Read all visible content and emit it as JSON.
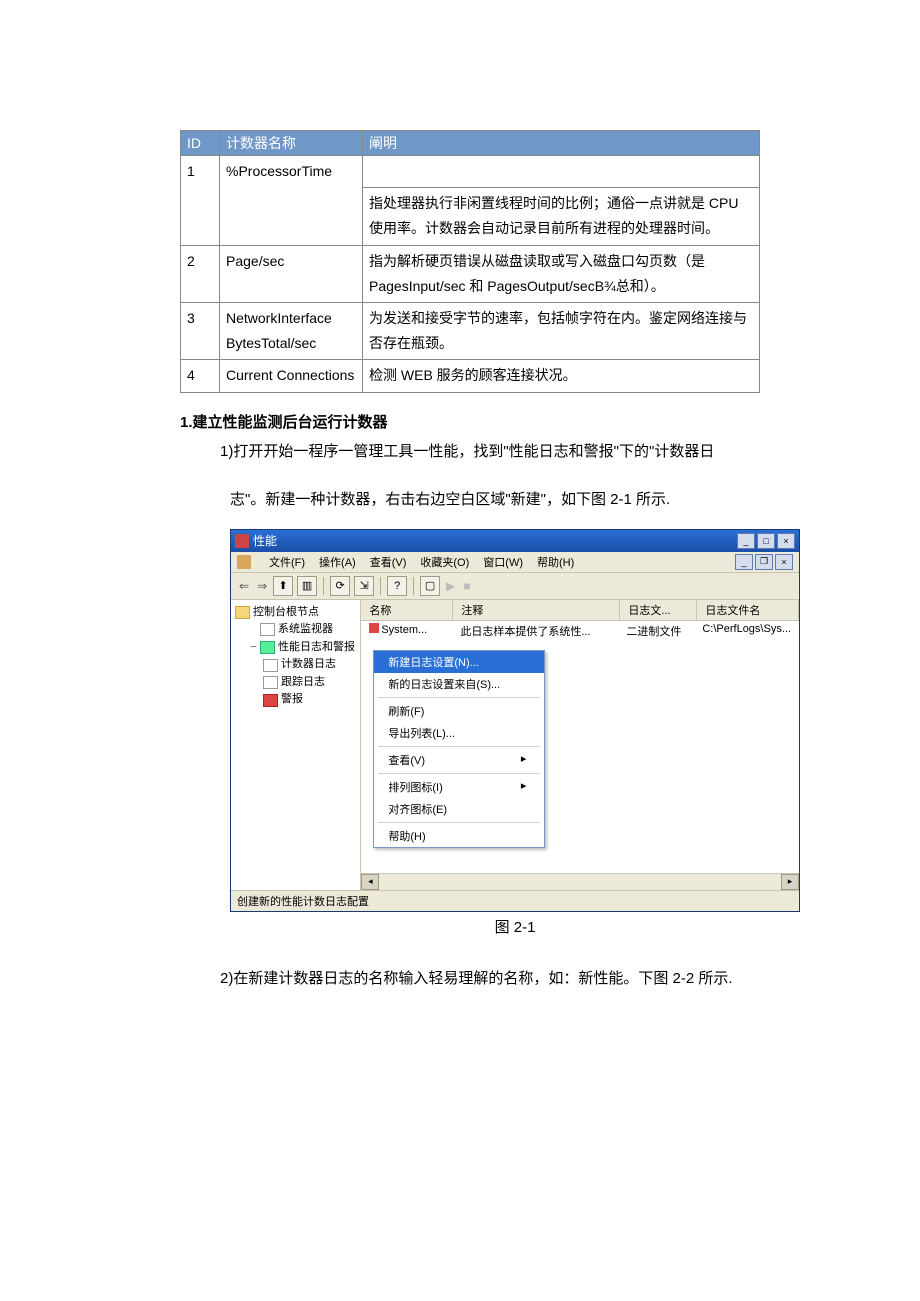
{
  "table": {
    "headers": {
      "id": "ID",
      "name": "计数器名称",
      "desc": "阐明"
    },
    "rows": [
      {
        "id": "1",
        "name": "%ProcessorTime",
        "desc": "指处理器执行非闲置线程时间的比例；通俗一点讲就是 CPU 使用率。计数器会自动记录目前所有进程的处理器时间。"
      },
      {
        "id": "2",
        "name": "Page/sec",
        "desc": "指为解析硬页错误从磁盘读取或写入磁盘口勾页数（是 PagesInput/sec 和 PagesOutput/secB¾总和）。"
      },
      {
        "id": "3",
        "name": "NetworkInterface BytesTotal/sec",
        "desc": "为发送和接受字节的速率，包括帧字符在内。鉴定网络连接与否存在瓶颈。"
      },
      {
        "id": "4",
        "name": "Current Connections",
        "desc": "检测 WEB 服务的顾客连接状况。"
      }
    ]
  },
  "section": {
    "heading": "1.建立性能监测后台运行计数器"
  },
  "para1a": "1)打开开始一程序一管理工具一性能，找到\"性能日志和警报\"下的\"计数器日",
  "para1b": "志\"。新建一种计数器，右击右边空白区域\"新建\"，如下图 2-1 所示.",
  "figcap": "图 2-1",
  "para2": "2)在新建计数器日志的名称输入轻易理解的名称，如：新性能。下图 2-2 所示.",
  "win": {
    "title": "性能",
    "menus": [
      "文件(F)",
      "操作(A)",
      "查看(V)",
      "收藏夹(O)",
      "窗口(W)",
      "帮助(H)"
    ],
    "tree": {
      "root": "控制台根节点",
      "n_sysmon": "系统监视器",
      "n_logs": "性能日志和警报",
      "n_counter": "计数器日志",
      "n_trace": "跟踪日志",
      "n_alert": "警报"
    },
    "list": {
      "h_name": "名称",
      "h_note": "注释",
      "h_type": "日志文...",
      "h_file": "日志文件名",
      "r_name": "System...",
      "r_note": "此日志样本提供了系统性...",
      "r_type": "二进制文件",
      "r_file": "C:\\PerfLogs\\Sys..."
    },
    "ctx": {
      "new_setting": "新建日志设置(N)...",
      "new_from": "新的日志设置来自(S)...",
      "refresh": "刷新(F)",
      "export": "导出列表(L)...",
      "view": "查看(V)",
      "arrange": "排列图标(I)",
      "align": "对齐图标(E)",
      "help": "帮助(H)"
    },
    "status": "创建新的性能计数日志配置"
  }
}
